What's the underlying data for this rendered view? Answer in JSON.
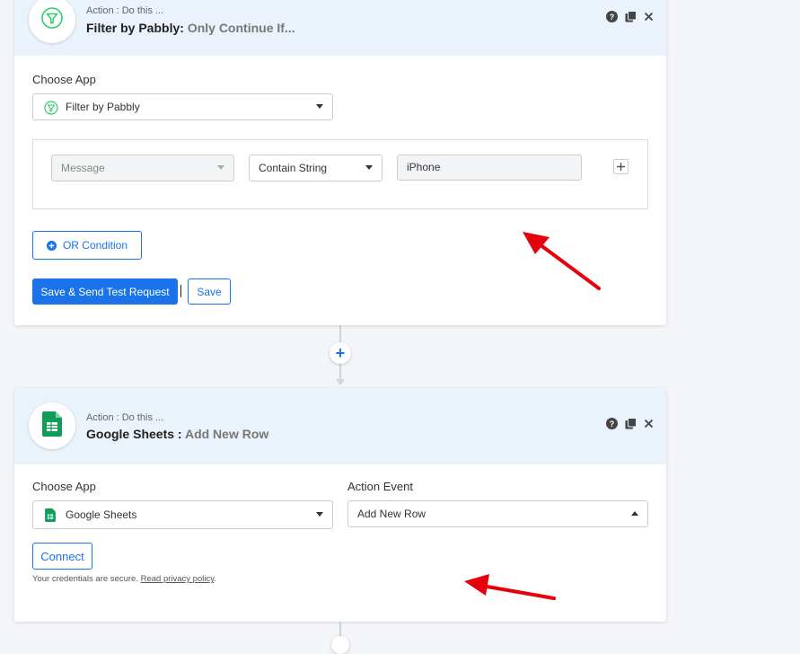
{
  "filter_step": {
    "subtitle": "Action : Do this ...",
    "app_name": "Filter by Pabbly:",
    "event_name": "Only Continue If...",
    "choose_app_label": "Choose App",
    "selected_app": "Filter by Pabbly",
    "condition": {
      "field_placeholder": "Message",
      "operator": "Contain String",
      "value": "iPhone"
    },
    "or_condition_label": "OR Condition",
    "save_send_label": "Save & Send Test Request",
    "save_label": "Save"
  },
  "add_step": {
    "plus": "+"
  },
  "sheets_step": {
    "subtitle": "Action : Do this ...",
    "app_name": "Google Sheets :",
    "event_name": "Add New Row",
    "choose_app_label": "Choose App",
    "selected_app": "Google Sheets",
    "action_event_label": "Action Event",
    "selected_event": "Add New Row",
    "connect_label": "Connect",
    "credentials_text": "Your credentials are secure.",
    "privacy_link": "Read privacy policy",
    "privacy_period": "."
  },
  "icons": {
    "help": "question-circle-icon",
    "copy": "copy-icon",
    "close": "close-icon",
    "filter": "filter-icon",
    "sheets": "google-sheets-icon",
    "annotation": "red-arrow"
  },
  "colors": {
    "accent": "#1a73e8",
    "header_bg": "#eaf2fb",
    "filter_green": "#2ecc71",
    "sheets_green": "#0f9d58",
    "arrow_red": "#e5000b"
  }
}
